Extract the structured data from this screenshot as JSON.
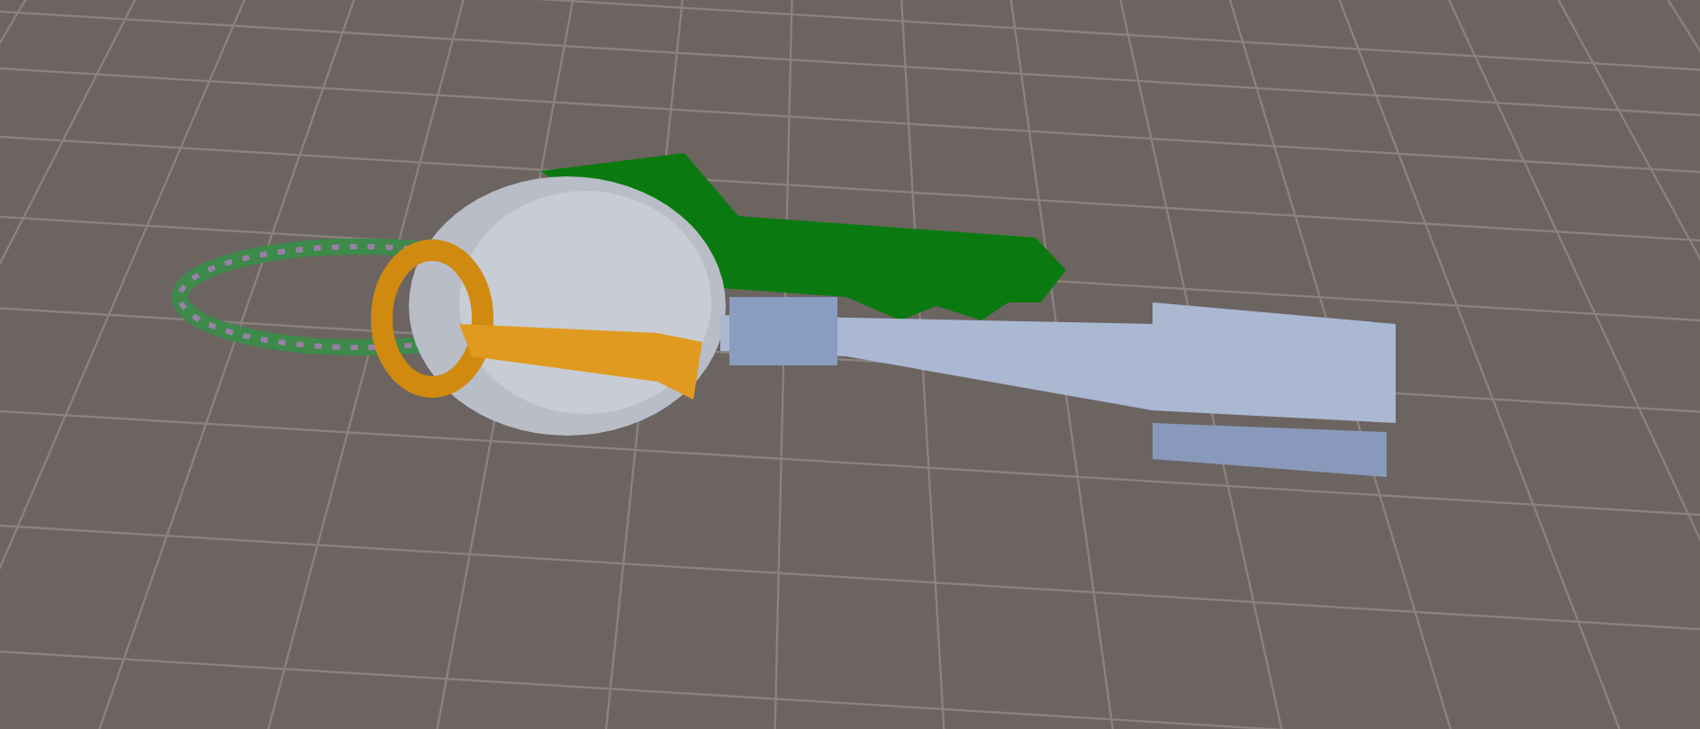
{
  "scene": {
    "grid": true
  }
}
